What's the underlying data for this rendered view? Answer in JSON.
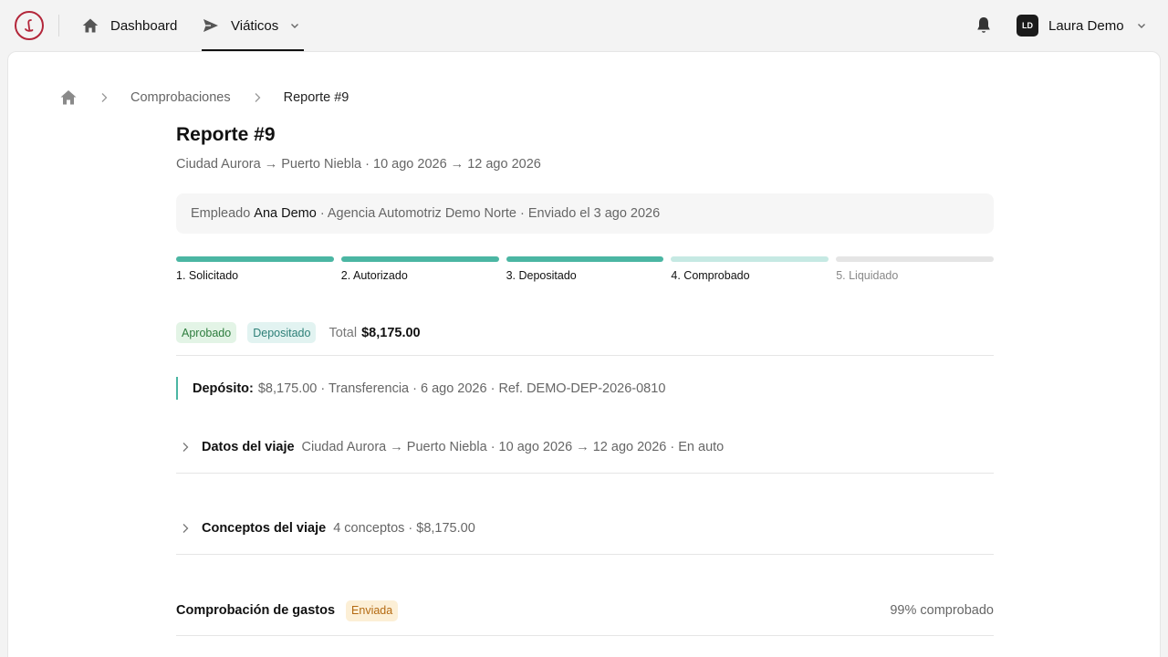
{
  "nav": {
    "dashboard_label": "Dashboard",
    "viaticos_label": "Viáticos",
    "avatar_initials": "LD",
    "user_name": "Laura Demo"
  },
  "breadcrumb": {
    "parent": "Comprobaciones",
    "current": "Reporte #9"
  },
  "report": {
    "title": "Reporte #9",
    "subtitle": "Ciudad Aurora → Puerto Niebla · 10 ago 2026 → 12 ago 2026",
    "employee_label": "Empleado",
    "employee_name": "Ana Demo",
    "employee_meta": "· Agencia Automotriz Demo Norte · Enviado el 3 ago 2026"
  },
  "steps": [
    {
      "label": "1. Solicitado",
      "state": "done"
    },
    {
      "label": "2. Autorizado",
      "state": "done"
    },
    {
      "label": "3. Depositado",
      "state": "done"
    },
    {
      "label": "4. Comprobado",
      "state": "current"
    },
    {
      "label": "5. Liquidado",
      "state": "pending"
    }
  ],
  "status": {
    "badge_approved": "Aprobado",
    "badge_deposited": "Depositado",
    "total_label": "Total",
    "total_value": "$8,175.00"
  },
  "deposit": {
    "label": "Depósito:",
    "details": "$8,175.00 · Transferencia · 6 ago 2026 · Ref. DEMO-DEP-2026-0810"
  },
  "sections": {
    "trip_title": "Datos del viaje",
    "trip_meta": "Ciudad Aurora → Puerto Niebla · 10 ago 2026 → 12 ago 2026 · En auto",
    "concepts_title": "Conceptos del viaje",
    "concepts_meta": "4 conceptos · $8,175.00"
  },
  "expenses": {
    "title": "Comprobación de gastos",
    "badge": "Enviada",
    "percent_text": "99% comprobado"
  },
  "colors": {
    "brand": "#b3263a",
    "step_done": "#4bb6a3",
    "step_current": "#c6e9e3",
    "step_pending": "#e5e5e5"
  }
}
